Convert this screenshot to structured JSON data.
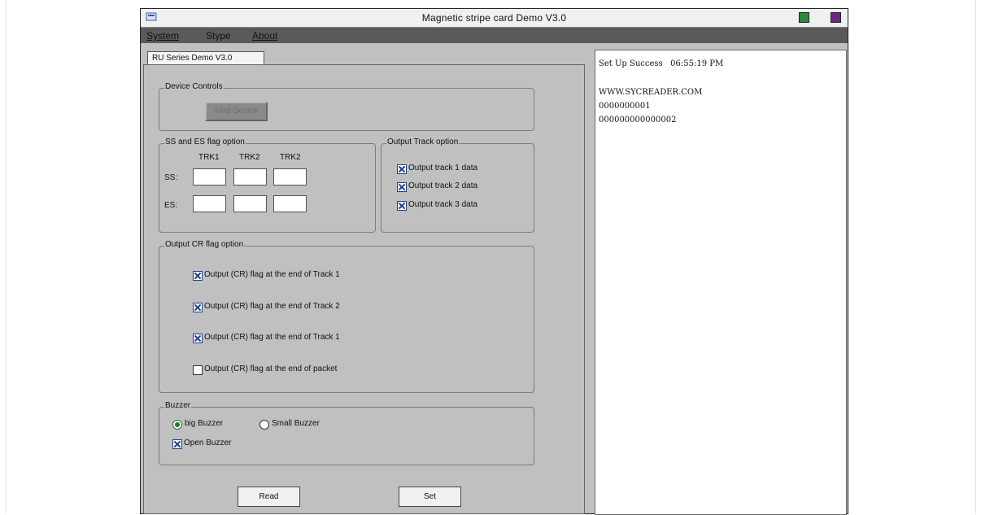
{
  "window": {
    "title": "Magnetic stripe card Demo V3.0"
  },
  "menu": {
    "system": "System",
    "stype": "Stype",
    "about": "About"
  },
  "tab": {
    "label": "RU Series Demo V3.0"
  },
  "device_controls": {
    "label": "Device Controls",
    "button_label": "Find Device",
    "button_enabled": false
  },
  "ss_es": {
    "label": "SS and ES flag option",
    "columns": [
      "TRK1",
      "TRK2",
      "TRK2"
    ],
    "ss_label": "SS:",
    "es_label": "ES:",
    "ss_values": [
      "",
      "",
      ""
    ],
    "es_values": [
      "",
      "",
      ""
    ]
  },
  "output_track": {
    "label": "Output Track option",
    "options": [
      {
        "label": "Output track 1 data",
        "checked": true
      },
      {
        "label": "Output track 2 data",
        "checked": true
      },
      {
        "label": "Output track 3 data",
        "checked": true
      }
    ]
  },
  "cr_flag": {
    "label": "Output CR flag option",
    "options": [
      {
        "label": "Output (CR) flag at the end of Track 1",
        "checked": true
      },
      {
        "label": "Output (CR) flag at the end of Track 2",
        "checked": true
      },
      {
        "label": "Output (CR) flag at the end of Track 1",
        "checked": true
      },
      {
        "label": "Output (CR) flag at the end of packet",
        "checked": false
      }
    ]
  },
  "buzzer": {
    "label": "Buzzer",
    "big": "big Buzzer",
    "small": "Small Buzzer",
    "selected": "big",
    "open_label": "Open Buzzer",
    "open_checked": true
  },
  "buttons": {
    "read": "Read",
    "set": "Set"
  },
  "log": {
    "lines": [
      "Set Up Success   06:55:19 PM",
      "",
      "WWW.SYCREADER.COM",
      "0000000001",
      "000000000000002"
    ]
  },
  "colors": {
    "window_bg": "#c0c0c0",
    "menubar_bg": "#5a5a5a",
    "check_accent": "#1a3e8f",
    "radio_accent": "#207a2a"
  }
}
